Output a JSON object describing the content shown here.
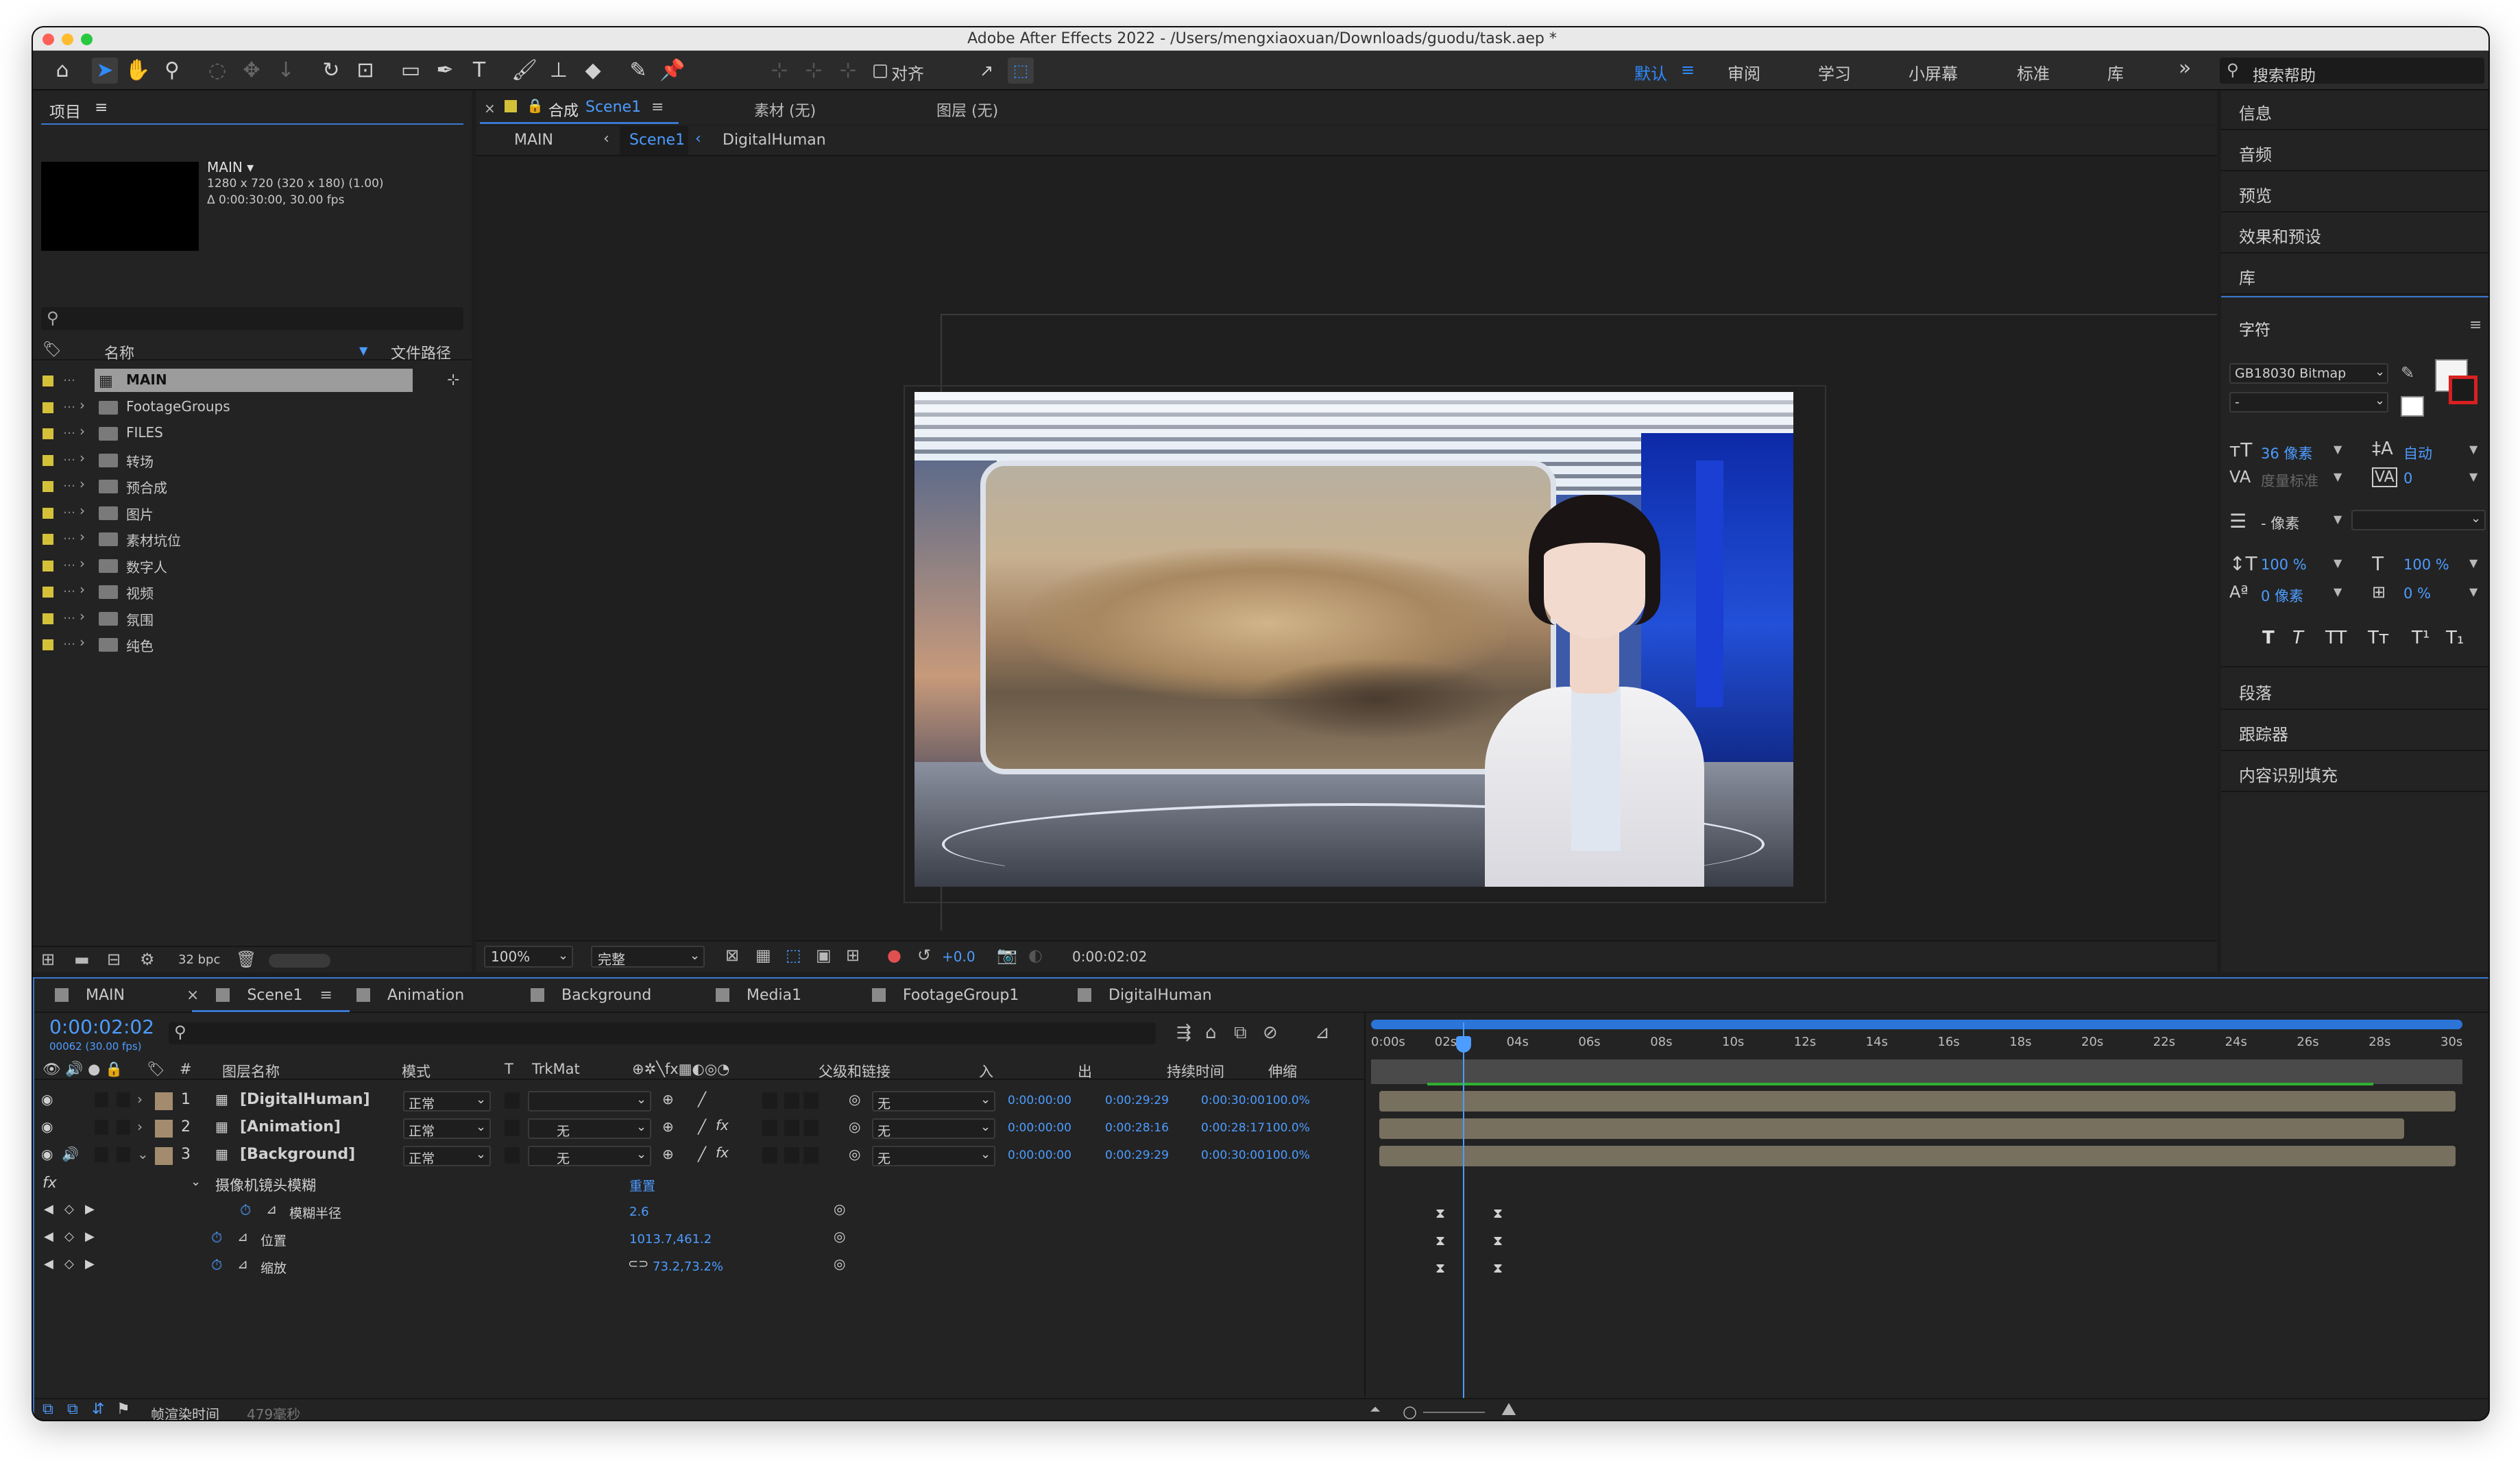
{
  "window": {
    "title": "Adobe After Effects 2022 - /Users/mengxiaoxuan/Downloads/guodu/task.aep *",
    "traffic_colors": [
      "#ff5f57",
      "#febc2e",
      "#28c840"
    ]
  },
  "toolbar": {
    "snap_label": "对齐",
    "workspaces": [
      "默认",
      "审阅",
      "学习",
      "小屏幕",
      "标准",
      "库"
    ],
    "active_workspace": "默认",
    "more": "»",
    "search_placeholder": "搜索帮助"
  },
  "project": {
    "title": "项目",
    "menu": "≡",
    "comp_name": "MAIN ▾",
    "comp_info1": "1280 x 720  (320 x 180) (1.00)",
    "comp_info2": "Δ 0:00:30:00, 30.00 fps",
    "search_placeholder": "",
    "col_name": "名称",
    "col_path": "文件路径",
    "items": [
      {
        "label": "MAIN",
        "selected": true
      },
      {
        "label": "FootageGroups"
      },
      {
        "label": "FILES"
      },
      {
        "label": "转场"
      },
      {
        "label": "预合成"
      },
      {
        "label": "图片"
      },
      {
        "label": "素材坑位"
      },
      {
        "label": "数字人"
      },
      {
        "label": "视频"
      },
      {
        "label": "氛围"
      },
      {
        "label": "纯色"
      }
    ],
    "bpc": "32 bpc"
  },
  "viewer": {
    "tab_comp": "合成",
    "tab_comp_name": "Scene1",
    "tab_footage": "素材  (无)",
    "tab_layer": "图层  (无)",
    "breadcrumb": [
      "MAIN",
      "Scene1",
      "DigitalHuman"
    ],
    "zoom": "100%",
    "quality": "完整",
    "exposure": "+0.0",
    "timecode": "0:00:02:02"
  },
  "right_panel": {
    "items_top": [
      "信息",
      "音频",
      "预览",
      "效果和预设",
      "库"
    ],
    "character_title": "字符",
    "font_name": "GB18030 Bitmap",
    "font_style": "-",
    "size": "36 像素",
    "leading": "自动",
    "kerning": "度量标准",
    "tracking": "0",
    "stroke": "- 像素",
    "vscale": "100 %",
    "hscale": "100 %",
    "baseline": "0 像素",
    "tsume": "0 %",
    "styles": [
      "T",
      "T",
      "TT",
      "Tт",
      "T¹",
      "T₁"
    ],
    "items_bottom": [
      "段落",
      "跟踪器",
      "内容识别填充"
    ]
  },
  "timeline": {
    "tabs": [
      "MAIN",
      "Scene1",
      "Animation",
      "Background",
      "Media1",
      "FootageGroup1",
      "DigitalHuman"
    ],
    "tab_colors": [
      "#8a8a8a",
      "#8a8a8a",
      "#8a8a8a",
      "#8a8a8a",
      "#8a8a8a",
      "#8a8a8a",
      "#8a8a8a"
    ],
    "active_tab": "Scene1",
    "timecode": "0:00:02:02",
    "frame_info": "00062 (30.00 fps)",
    "col_headers": {
      "name": "图层名称",
      "mode": "模式",
      "t": "T",
      "trkmat": "TrkMat",
      "parent": "父级和链接",
      "in": "入",
      "out": "出",
      "duration": "持续时间",
      "stretch": "伸缩",
      "hash": "#"
    },
    "layers": [
      {
        "num": "1",
        "name": "[DigitalHuman]",
        "mode": "正常",
        "trkmat": "",
        "parent": "无",
        "in": "0:00:00:00",
        "out": "0:00:29:29",
        "dur": "0:00:30:00",
        "stretch": "100.0%"
      },
      {
        "num": "2",
        "name": "[Animation]",
        "mode": "正常",
        "trkmat": "无",
        "parent": "无",
        "in": "0:00:00:00",
        "out": "0:00:28:16",
        "dur": "0:00:28:17",
        "stretch": "100.0%"
      },
      {
        "num": "3",
        "name": "[Background]",
        "mode": "正常",
        "trkmat": "无",
        "parent": "无",
        "in": "0:00:00:00",
        "out": "0:00:29:29",
        "dur": "0:00:30:00",
        "stretch": "100.0%"
      }
    ],
    "effect_name": "摄像机镜头模糊",
    "effect_reset": "重置",
    "props": [
      {
        "name": "模糊半径",
        "value": "2.6"
      },
      {
        "name": "位置",
        "value": "1013.7,461.2"
      },
      {
        "name": "缩放",
        "value": "73.2,73.2%"
      }
    ],
    "ruler": [
      "0:00s",
      "02s",
      "04s",
      "06s",
      "08s",
      "10s",
      "12s",
      "14s",
      "16s",
      "18s",
      "20s",
      "22s",
      "24s",
      "26s",
      "28s",
      "30s"
    ],
    "playhead_seconds": 2.07,
    "duration_seconds": 30,
    "render_label": "帧渲染时间",
    "render_value": "479毫秒"
  }
}
